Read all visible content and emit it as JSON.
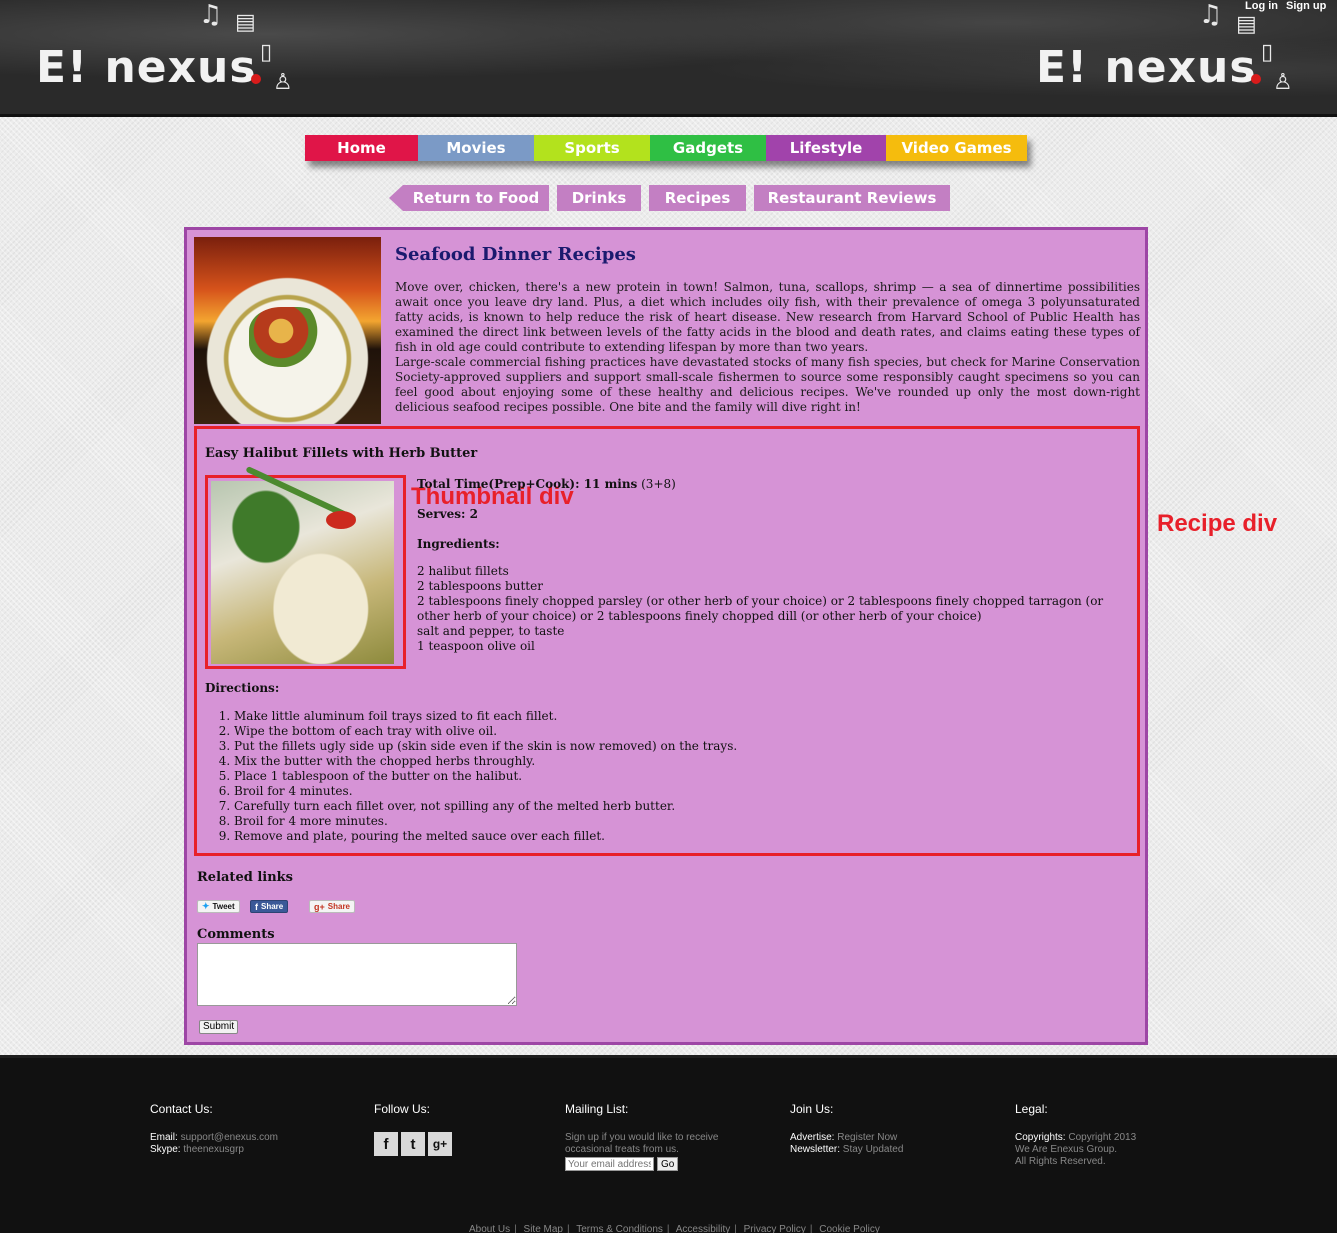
{
  "header": {
    "logo_text": "E! nexus",
    "login": "Log in",
    "signup": "Sign up"
  },
  "main_nav": [
    {
      "label": "Home",
      "color": "#e01548"
    },
    {
      "label": "Movies",
      "color": "#7b9ac6"
    },
    {
      "label": "Sports",
      "color": "#b3e21d"
    },
    {
      "label": "Gadgets",
      "color": "#2fbf44"
    },
    {
      "label": "Lifestyle",
      "color": "#a143ab"
    },
    {
      "label": "Video Games",
      "color": "#f5bc0d"
    }
  ],
  "sub_nav": [
    "Return to Food",
    "Drinks",
    "Recipes",
    "Restaurant Reviews"
  ],
  "article": {
    "title": "Seafood Dinner Recipes",
    "intro_p1": "Move over, chicken, there's a new protein in town! Salmon, tuna, scallops, shrimp — a sea of dinnertime possibilities await once you leave dry land. Plus, a diet which includes oily fish, with their prevalence of omega 3 polyunsaturated fatty acids, is known to help reduce the risk of heart disease. New research from Harvard School of Public Health has examined the direct link between levels of the fatty acids in the blood and death rates, and claims eating these types of fish in old age could contribute to extending lifespan by more than two years.",
    "intro_p2": "Large-scale commercial fishing practices have devastated stocks of many fish species, but check for Marine Conservation Society-approved suppliers and support small-scale fishermen to source some responsibly caught specimens so you can feel good about enjoying some of these healthy and delicious recipes. We've rounded up only the most down-right delicious seafood recipes possible. One bite and the family will dive right in!"
  },
  "recipe": {
    "title": "Easy Halibut Fillets with Herb Butter",
    "total_time_label": "Total Time(Prep+Cook): 11 mins",
    "total_time_detail": " (3+8)",
    "serves": "Serves: 2",
    "ingredients_label": "Ingredients:",
    "ingredients": [
      "2 halibut fillets",
      "2 tablespoons butter",
      "2 tablespoons finely chopped parsley (or other herb of your choice) or 2 tablespoons finely chopped tarragon (or other herb of your choice) or 2 tablespoons finely chopped dill (or other herb of your choice)",
      "salt and pepper, to taste",
      "1 teaspoon olive oil"
    ],
    "directions_label": "Directions:",
    "directions": [
      "Make little aluminum foil trays sized to fit each fillet.",
      "Wipe the bottom of each tray with olive oil.",
      "Put the fillets ugly side up (skin side even if the skin is now removed) on the trays.",
      "Mix the butter with the chopped herbs throughly.",
      "Place 1 tablespoon of the butter on the halibut.",
      "Broil for 4 minutes.",
      "Carefully turn each fillet over, not spilling any of the melted herb butter.",
      "Broil for 4 more minutes.",
      "Remove and plate, pouring the melted sauce over each fillet."
    ]
  },
  "annotations": {
    "thumbnail": "Thumbnail div",
    "recipe": "Recipe div"
  },
  "related": {
    "label": "Related links",
    "tweet": "Tweet",
    "fb_share": "Share",
    "gplus_share": "Share"
  },
  "comments": {
    "label": "Comments",
    "submit": "Submit"
  },
  "footer": {
    "contact": {
      "heading": "Contact Us:",
      "email_label": "Email:",
      "email": "support@enexus.com",
      "skype_label": "Skype:",
      "skype": "theenexusgrp"
    },
    "follow": {
      "heading": "Follow Us:"
    },
    "mailing": {
      "heading": "Mailing List:",
      "text": "Sign up if you would like to receive occasional treats from us.",
      "placeholder": "Your email address",
      "go": "Go"
    },
    "join": {
      "heading": "Join Us:",
      "advertise_label": "Advertise:",
      "advertise": "Register Now",
      "newsletter_label": "Newsletter:",
      "newsletter": "Stay Updated"
    },
    "legal": {
      "heading": "Legal:",
      "copyrights_label": "Copyrights:",
      "line1": "Copyright 2013",
      "line2": "We Are Enexus Group.",
      "line3": "All Rights Reserved."
    },
    "links": [
      "About Us",
      "Site Map",
      "Terms & Conditions",
      "Accessibility",
      "Privacy Policy",
      "Cookie Policy"
    ]
  }
}
